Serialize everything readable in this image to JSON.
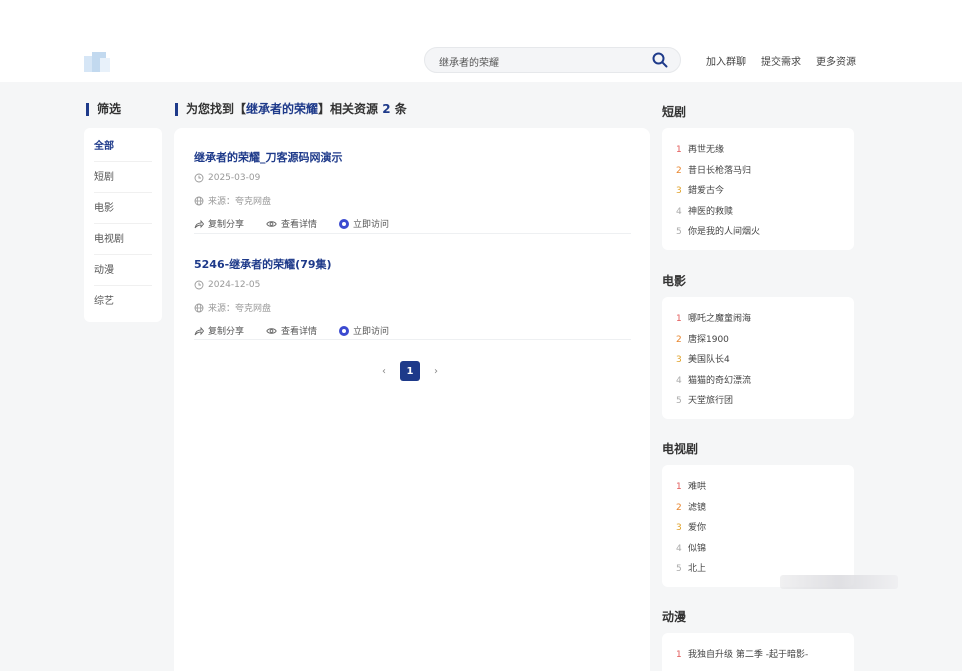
{
  "header": {
    "search": {
      "value": "继承者的荣耀",
      "icon": "search-icon"
    },
    "nav": [
      "加入群聊",
      "提交需求",
      "更多资源"
    ]
  },
  "filter": {
    "title": "筛选",
    "items": [
      "全部",
      "短剧",
      "电影",
      "电视剧",
      "动漫",
      "综艺"
    ],
    "active": "全部"
  },
  "results": {
    "prefix": "为您找到【",
    "keyword": "继承者的荣耀",
    "middle": "】相关资源 ",
    "count": "2",
    "suffix": " 条",
    "items": [
      {
        "title": "继承者的荣耀_刀客源码网演示",
        "date": "2025-03-09",
        "source": "来源：夸克网盘",
        "share": "复制分享",
        "detail": "查看详情",
        "visit": "立即访问"
      },
      {
        "title": "5246-继承者的荣耀(79集)",
        "date": "2024-12-05",
        "source": "来源：夸克网盘",
        "share": "复制分享",
        "detail": "查看详情",
        "visit": "立即访问"
      }
    ]
  },
  "pagination": {
    "prev": "‹",
    "current": "1",
    "next": "›"
  },
  "sidebar": [
    {
      "title": "短剧",
      "items": [
        "再世无缘",
        "昔日长枪落马归",
        "錯爱古今",
        "神医的救赎",
        "你是我的人间烟火"
      ]
    },
    {
      "title": "电影",
      "items": [
        "哪吒之魔童闹海",
        "唐探1900",
        "美国队长4",
        "猫猫的奇幻漂流",
        "天堂旅行团"
      ]
    },
    {
      "title": "电视剧",
      "items": [
        "难哄",
        "滤镜",
        "爱你",
        "似锦",
        "北上"
      ]
    },
    {
      "title": "动漫",
      "items": [
        "我独自升级 第二季 -起于暗影-"
      ]
    }
  ],
  "colors": {
    "accent": "#1e3a8a",
    "rank1": "#e25a5a",
    "rank2": "#e8852d",
    "rank3": "#e0a22a"
  }
}
